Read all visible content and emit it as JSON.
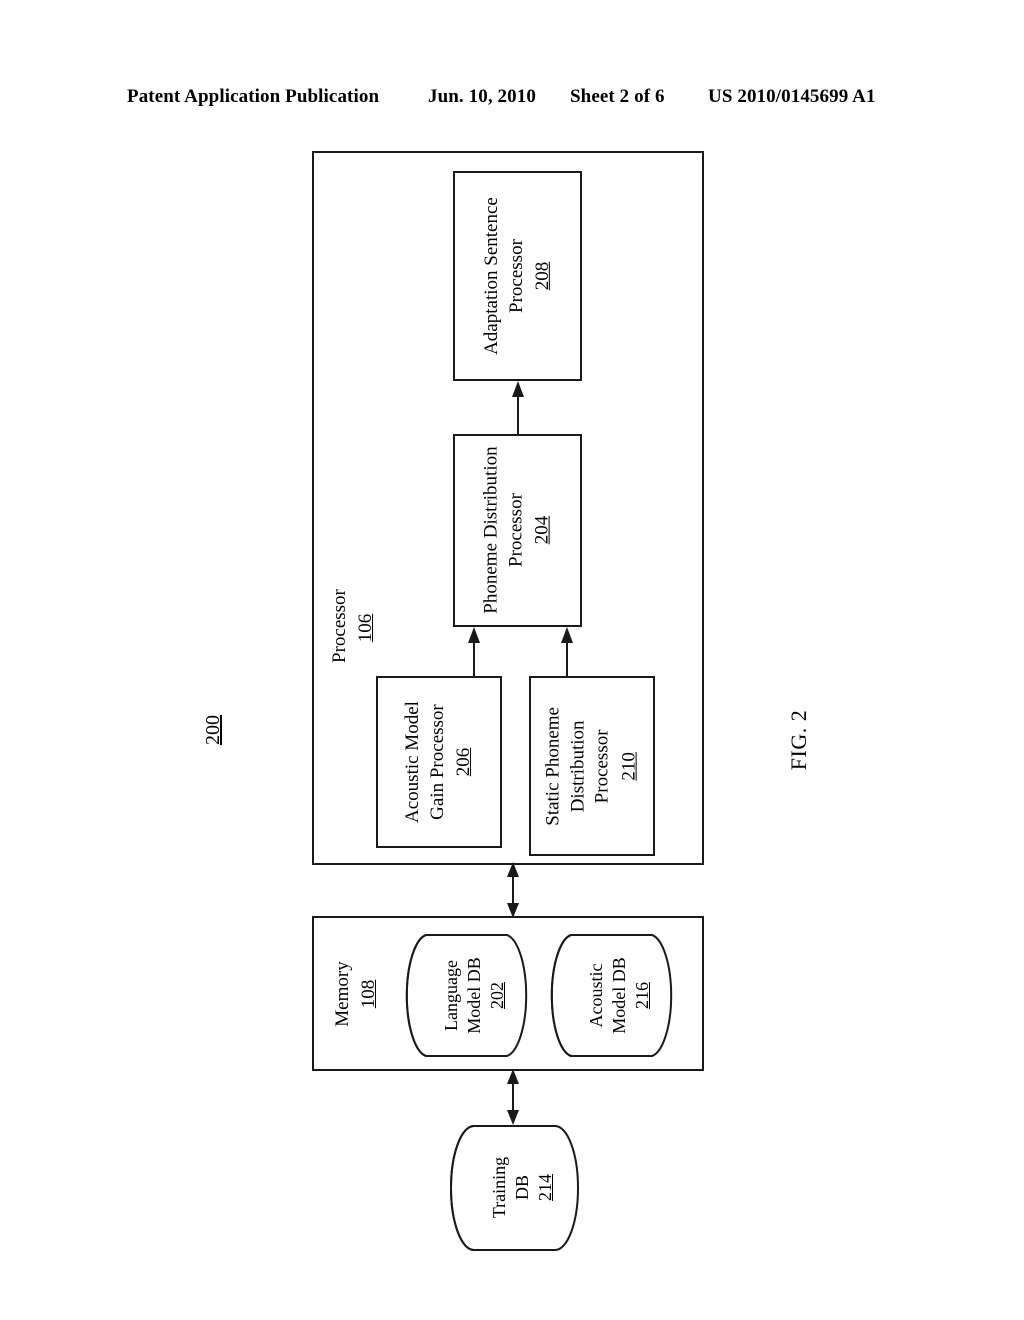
{
  "header": {
    "publication": "Patent Application Publication",
    "date": "Jun. 10, 2010",
    "sheet": "Sheet 2 of 6",
    "patent_number": "US 2010/0145699 A1"
  },
  "figure": {
    "label": "FIG. 2",
    "system_reference": "200"
  },
  "diagram": {
    "processor_container": {
      "name": "Processor",
      "ref": "106"
    },
    "memory_container": {
      "name": "Memory",
      "ref": "108"
    },
    "blocks": [
      {
        "id": "adaptation-sentence-processor",
        "lines": [
          "Adaptation Sentence",
          "Processor"
        ],
        "ref": "208"
      },
      {
        "id": "phoneme-distribution-processor",
        "lines": [
          "Phoneme Distribution",
          "Processor"
        ],
        "ref": "204"
      },
      {
        "id": "acoustic-model-gain-processor",
        "lines": [
          "Acoustic Model",
          "Gain Processor"
        ],
        "ref": "206"
      },
      {
        "id": "static-phoneme-distribution-processor",
        "lines": [
          "Static Phoneme",
          "Distribution",
          "Processor"
        ],
        "ref": "210"
      }
    ],
    "databases": [
      {
        "id": "language-model-db",
        "lines": [
          "Language",
          "Model DB"
        ],
        "ref": "202"
      },
      {
        "id": "acoustic-model-db",
        "lines": [
          "Acoustic",
          "Model DB"
        ],
        "ref": "216"
      },
      {
        "id": "training-db",
        "lines": [
          "Training",
          "DB"
        ],
        "ref": "214"
      }
    ],
    "connections": [
      {
        "id": "conn-204-to-208",
        "from": "phoneme-distribution-processor",
        "to": "adaptation-sentence-processor",
        "style": "single-arrow"
      },
      {
        "id": "conn-206-to-204",
        "from": "acoustic-model-gain-processor",
        "to": "phoneme-distribution-processor",
        "style": "single-arrow"
      },
      {
        "id": "conn-210-to-204",
        "from": "static-phoneme-distribution-processor",
        "to": "phoneme-distribution-processor",
        "style": "single-arrow"
      },
      {
        "id": "conn-processor-memory",
        "from": "Processor",
        "to": "Memory",
        "style": "double-arrow"
      },
      {
        "id": "conn-memory-training",
        "from": "Memory",
        "to": "training-db",
        "style": "double-arrow"
      }
    ]
  },
  "colors": {
    "ink": "#1a1a1a",
    "paper": "#ffffff"
  }
}
